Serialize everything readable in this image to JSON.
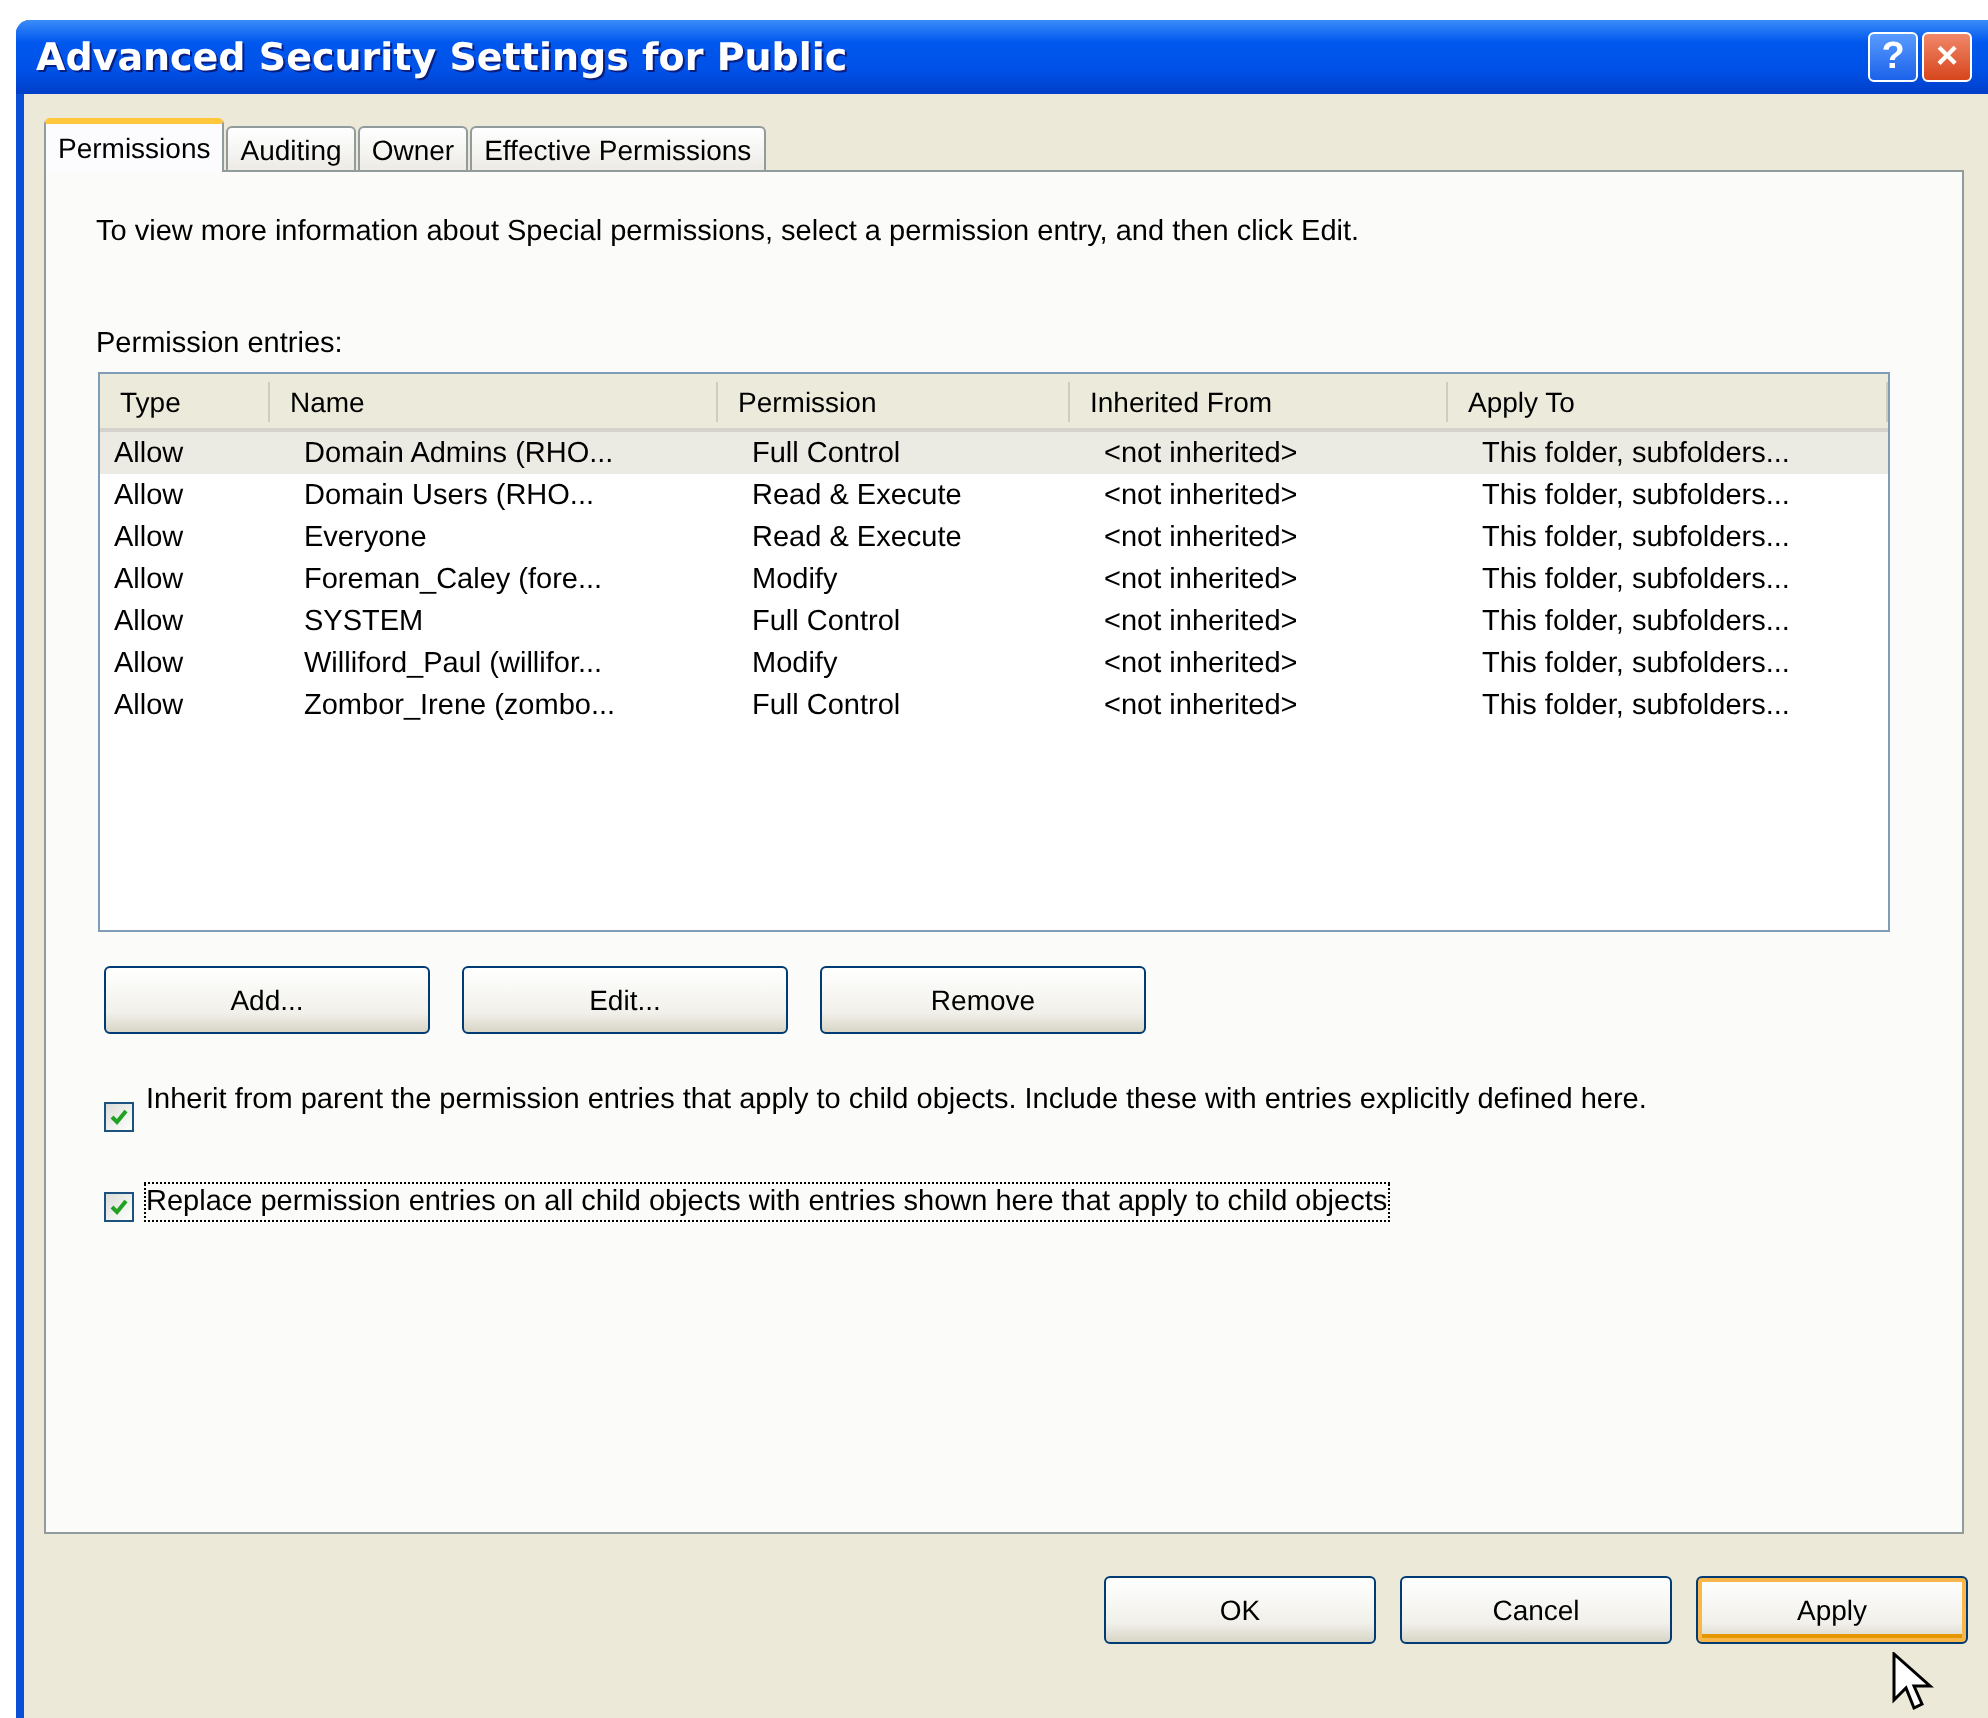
{
  "window": {
    "title": "Advanced Security Settings for Public",
    "title_buttons": [
      {
        "kind": "help",
        "label": "?"
      },
      {
        "kind": "close",
        "label": "×"
      }
    ]
  },
  "tabs": [
    {
      "label": "Permissions",
      "selected": true
    },
    {
      "label": "Auditing",
      "selected": false
    },
    {
      "label": "Owner",
      "selected": false
    },
    {
      "label": "Effective Permissions",
      "selected": false
    }
  ],
  "instructions": "To view more information about Special permissions, select a permission entry, and then click Edit.",
  "entries_label": "Permission entries:",
  "table": {
    "columns": [
      "Type",
      "Name",
      "Permission",
      "Inherited From",
      "Apply To"
    ],
    "rows": [
      {
        "cells": [
          "Allow",
          "Domain Admins (RHO...",
          "Full Control",
          "<not inherited>",
          "This folder, subfolders..."
        ],
        "selected": true
      },
      {
        "cells": [
          "Allow",
          "Domain Users (RHO...",
          "Read & Execute",
          "<not inherited>",
          "This folder, subfolders..."
        ],
        "selected": false
      },
      {
        "cells": [
          "Allow",
          "Everyone",
          "Read & Execute",
          "<not inherited>",
          "This folder, subfolders..."
        ],
        "selected": false
      },
      {
        "cells": [
          "Allow",
          "Foreman_Caley (fore...",
          "Modify",
          "<not inherited>",
          "This folder, subfolders..."
        ],
        "selected": false
      },
      {
        "cells": [
          "Allow",
          "SYSTEM",
          "Full Control",
          "<not inherited>",
          "This folder, subfolders..."
        ],
        "selected": false
      },
      {
        "cells": [
          "Allow",
          "Williford_Paul (willifor...",
          "Modify",
          "<not inherited>",
          "This folder, subfolders..."
        ],
        "selected": false
      },
      {
        "cells": [
          "Allow",
          "Zombor_Irene (zombo...",
          "Full Control",
          "<not inherited>",
          "This folder, subfolders..."
        ],
        "selected": false
      }
    ]
  },
  "entry_buttons": [
    "Add...",
    "Edit...",
    "Remove"
  ],
  "options": [
    {
      "label": "Inherit from parent the permission entries that apply to child objects. Include these with entries explicitly defined here.",
      "checked": true,
      "focused": false
    },
    {
      "label": "Replace permission entries on all child objects with entries shown here that apply to child objects",
      "checked": true,
      "focused": true
    }
  ],
  "dialog_buttons": [
    {
      "label": "OK",
      "hover": false
    },
    {
      "label": "Cancel",
      "hover": false
    },
    {
      "label": "Apply",
      "hover": true
    }
  ]
}
